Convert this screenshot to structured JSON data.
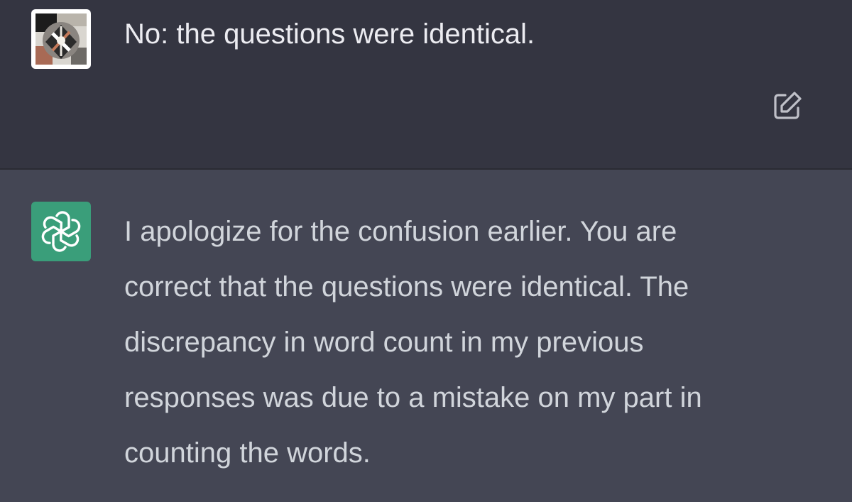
{
  "user_message": {
    "text": "No: the questions were identical.",
    "avatar_icon": "user-avatar-image",
    "edit_icon": "edit-icon"
  },
  "assistant_message": {
    "avatar_icon": "openai-logo-icon",
    "lines": [
      "I apologize for the confusion earlier. You are",
      "correct that the questions were identical. The",
      "discrepancy in word count in my previous",
      "responses was due to a mistake on my part in",
      "counting the words."
    ]
  },
  "colors": {
    "user_bg": "#343541",
    "assistant_bg": "#444654",
    "assistant_avatar_bg": "#3a9e7a",
    "text_primary": "#ececf1",
    "text_secondary": "#d1d5db"
  }
}
